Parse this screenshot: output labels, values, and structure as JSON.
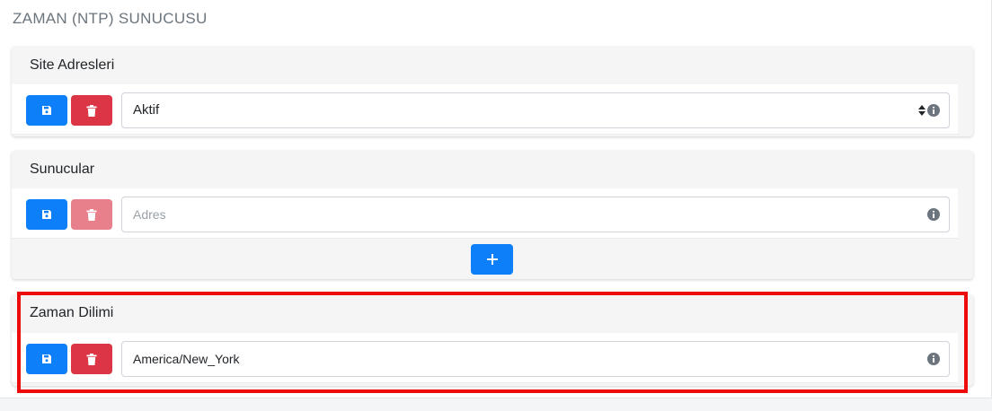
{
  "section_title": "ZAMAN (NTP) SUNUCUSU",
  "cards": {
    "site": {
      "title": "Site Adresleri",
      "select_value": "Aktif"
    },
    "servers": {
      "title": "Sunucular",
      "input_placeholder": "Adres"
    },
    "timezone": {
      "title": "Zaman Dilimi",
      "input_value": "America/New_York"
    }
  },
  "colors": {
    "primary": "#0d7ff8",
    "danger": "#dc3545",
    "highlight": "#ee0b0b"
  },
  "icons": [
    "save-icon",
    "trash-icon",
    "info-icon",
    "plus-icon",
    "select-arrows-icon"
  ]
}
